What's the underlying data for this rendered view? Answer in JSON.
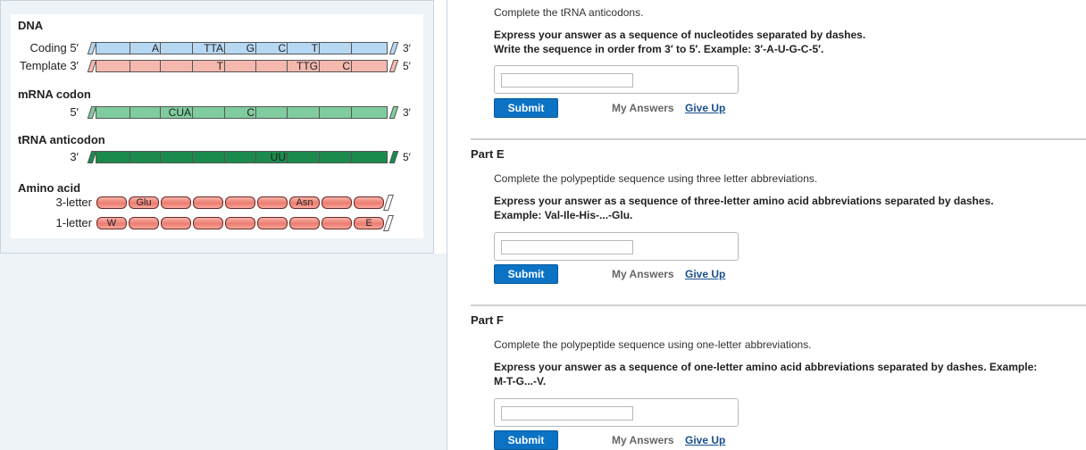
{
  "diagram": {
    "dna_heading": "DNA",
    "coding_label": "Coding 5′",
    "template_label": "Template 3′",
    "coding_end": "3′",
    "template_end": "5′",
    "mrna_heading": "mRNA codon",
    "mrna_start": "5′",
    "mrna_end": "3′",
    "trna_heading": "tRNA anticodon",
    "trna_start": "3′",
    "trna_end": "5′",
    "amino_heading": "Amino acid",
    "three_letter_label": "3-letter",
    "one_letter_label": "1-letter",
    "coding_codons": [
      "",
      "A",
      "",
      "TTA",
      "G",
      "C",
      "T",
      "",
      ""
    ],
    "template_codons": [
      "",
      "",
      "",
      "T",
      "",
      "",
      "TTG",
      "C",
      ""
    ],
    "mrna_codons": [
      "",
      "",
      "CUA",
      "",
      "C",
      "",
      "",
      "",
      ""
    ],
    "trna_codons": [
      "",
      "",
      "",
      "",
      "",
      "UU",
      "",
      "",
      ""
    ],
    "aa3": [
      "",
      "Glu",
      "",
      "",
      "",
      "",
      "Asn",
      "",
      ""
    ],
    "aa1": [
      "W",
      "",
      "",
      "",
      "",
      "",
      "",
      "",
      "E"
    ],
    "colors": {
      "coding": "#b6d8f3",
      "template": "#f4b8ae",
      "mrna": "#7fcc9f",
      "trna": "#1b8a4c"
    }
  },
  "part_d": {
    "instruction": "Complete the tRNA anticodons.",
    "express": "Express your answer as a sequence of nucleotides separated by dashes.",
    "write": "Write the sequence in order from 3′ to 5′. Example: 3′-A-U-G-C-5′.",
    "submit": "Submit",
    "my_answers": "My Answers",
    "give_up": "Give Up"
  },
  "part_e": {
    "title": "Part E",
    "instruction": "Complete the polypeptide sequence using three letter abbreviations.",
    "express": "Express your answer as a sequence of three-letter amino acid abbreviations separated by dashes.",
    "example": "Example: Val-Ile-His-...-Glu.",
    "submit": "Submit",
    "my_answers": "My Answers",
    "give_up": "Give Up"
  },
  "part_f": {
    "title": "Part F",
    "instruction": "Complete the polypeptide sequence using one-letter abbreviations.",
    "express": "Express your answer as a sequence of one-letter amino acid abbreviations separated by dashes. Example:",
    "example": "M-T-G...-V.",
    "submit": "Submit",
    "my_answers": "My Answers",
    "give_up": "Give Up"
  }
}
